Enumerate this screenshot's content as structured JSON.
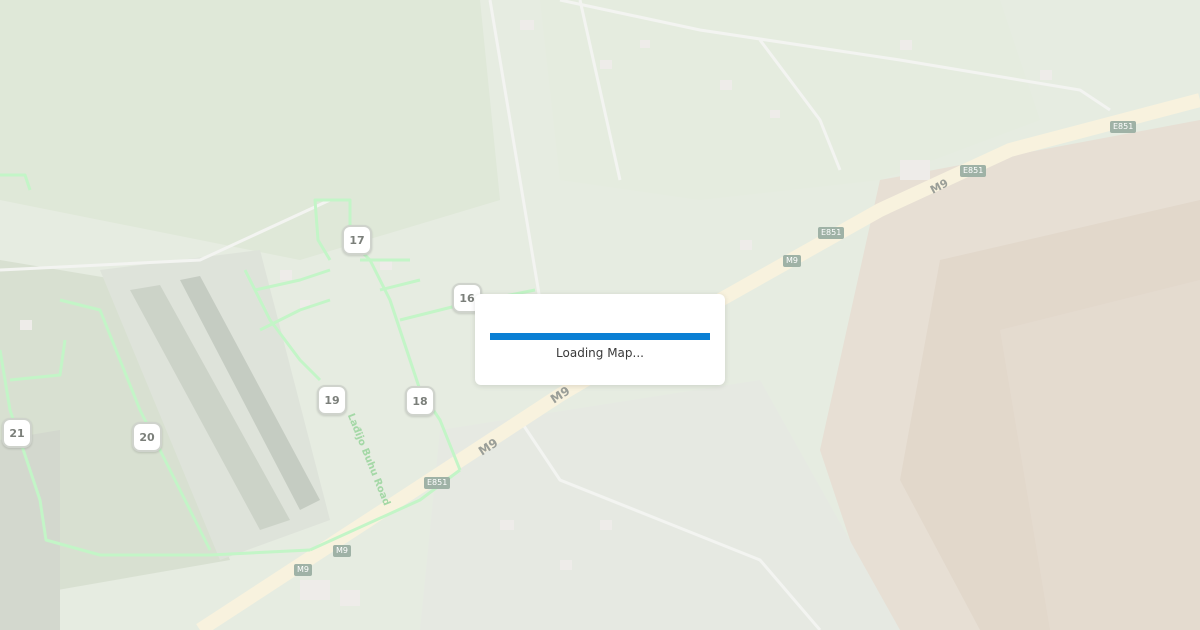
{
  "map": {
    "markers": [
      {
        "id": "17",
        "label": "17"
      },
      {
        "id": "16",
        "label": "16"
      },
      {
        "id": "19",
        "label": "19"
      },
      {
        "id": "18",
        "label": "18"
      },
      {
        "id": "21",
        "label": "21"
      },
      {
        "id": "20",
        "label": "20"
      }
    ],
    "road_labels": {
      "m9_a": "M9",
      "m9_b": "M9",
      "m9_c": "M9"
    },
    "shields": {
      "e851_a": "E851",
      "e851_b": "E851",
      "e851_c": "E851",
      "e851_d": "E851",
      "m9_a": "M9",
      "m9_b": "M9",
      "m9_c": "M9"
    },
    "street_label": "Lađijo Buhu Road",
    "colors": {
      "route": "#6fdc78",
      "highway": "#f3e6b8",
      "field": "#8aa878",
      "forest": "#9c8a70"
    }
  },
  "loading": {
    "text": "Loading Map...",
    "progress_percent": 100,
    "accent": "#0a7fd4"
  }
}
